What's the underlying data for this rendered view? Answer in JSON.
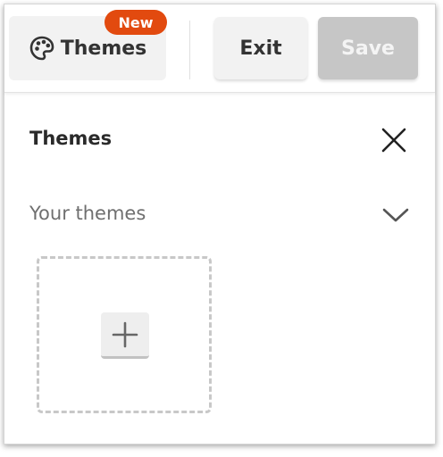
{
  "toolbar": {
    "themes_label": "Themes",
    "new_badge": "New",
    "exit_label": "Exit",
    "save_label": "Save",
    "themes_icon": "palette-icon"
  },
  "panel": {
    "title": "Themes",
    "close_icon": "close-icon",
    "section_label": "Your themes",
    "section_toggle_icon": "chevron-down-icon",
    "add_theme_icon": "plus-icon"
  },
  "colors": {
    "badge_bg": "#e24a0f",
    "save_disabled_bg": "#c6c6c6",
    "button_bg": "#f2f2f2",
    "text_dark": "#333333",
    "text_muted": "#6f6f6f"
  }
}
